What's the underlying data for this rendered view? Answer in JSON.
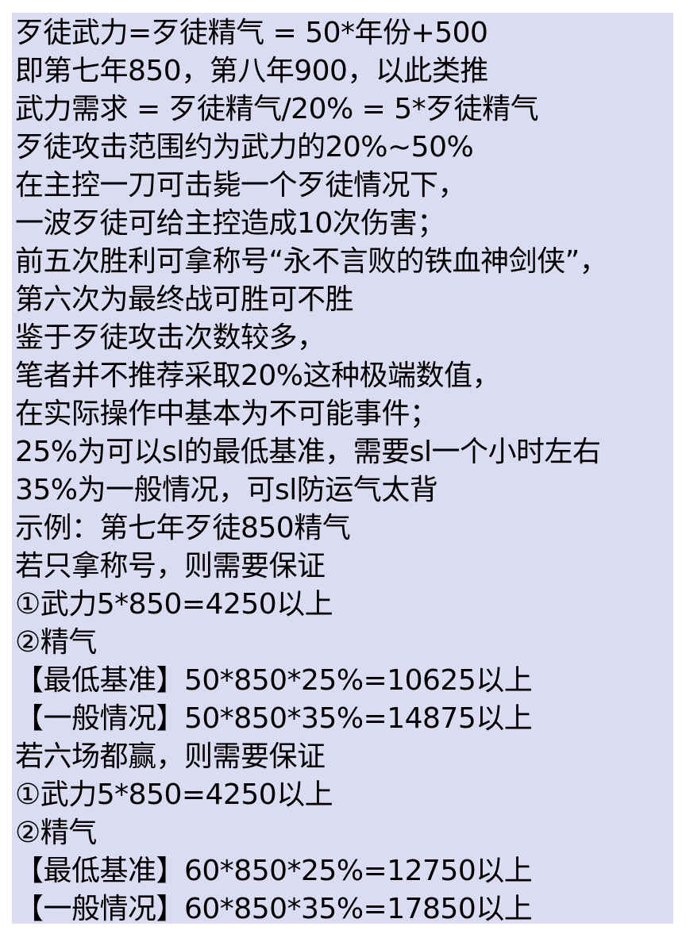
{
  "document": {
    "background_color": "#dbdcf1",
    "text_color": "#000000",
    "lines": [
      "歹徒武力=歹徒精气 = 50*年份+500",
      "即第七年850，第八年900，以此类推",
      "武力需求 = 歹徒精气/20% = 5*歹徒精气",
      "歹徒攻击范围约为武力的20%~50%",
      "在主控一刀可击毙一个歹徒情况下，",
      "一波歹徒可给主控造成10次伤害；",
      "前五次胜利可拿称号“永不言败的铁血神剑侠”，",
      "第六次为最终战可胜可不胜",
      "鉴于歹徒攻击次数较多，",
      "笔者并不推荐采取20%这种极端数值，",
      "在实际操作中基本为不可能事件；",
      "25%为可以sl的最低基准，需要sl一个小时左右",
      "35%为一般情况，可sl防运气太背",
      "示例：第七年歹徒850精气",
      "若只拿称号，则需要保证",
      "①武力5*850=4250以上",
      "②精气",
      "【最低基准】50*850*25%=10625以上",
      "【一般情况】50*850*35%=14875以上",
      "若六场都赢，则需要保证",
      "①武力5*850=4250以上",
      "②精气",
      "【最低基准】60*850*25%=12750以上",
      "【一般情况】60*850*35%=17850以上"
    ]
  }
}
